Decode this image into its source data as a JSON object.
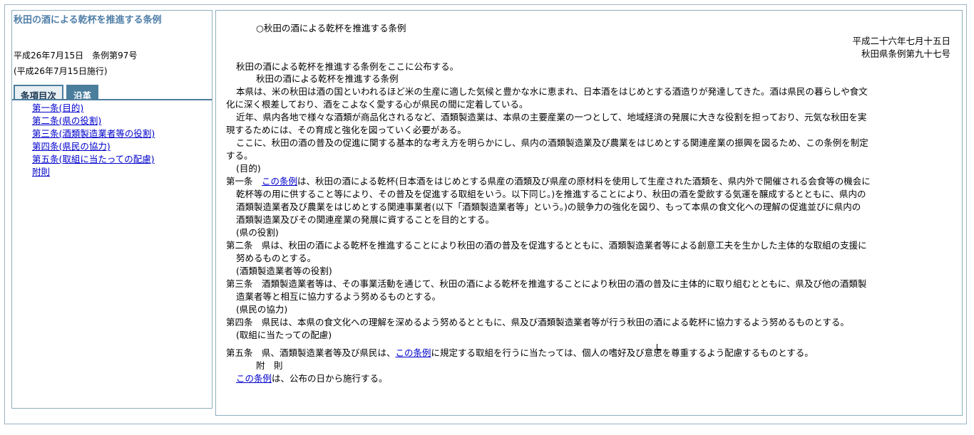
{
  "left": {
    "title": "秋田の酒による乾杯を推進する条例",
    "date_number": "平成26年7月15日　条例第97号",
    "effective": "(平成26年7月15日施行)",
    "tabs": [
      "条項目次",
      "沿革"
    ],
    "toc": [
      "第一条(目的)",
      "第二条(県の役割)",
      "第三条(酒類製造業者等の役割)",
      "第四条(県民の協力)",
      "第五条(取組に当たっての配慮)",
      "附則"
    ]
  },
  "doc": {
    "heading": "○秋田の酒による乾杯を推進する条例",
    "date": "平成二十六年七月十五日",
    "number": "秋田県条例第九十七号",
    "promulgation": "秋田の酒による乾杯を推進する条例をここに公布する。",
    "title": "秋田の酒による乾杯を推進する条例",
    "preamble": [
      "本県は、米の秋田は酒の国といわれるほど米の生産に適した気候と豊かな水に恵まれ、日本酒をはじめとする酒造りが発達してきた。酒は県民の暮らしや食文",
      "化に深く根差しており、酒をこよなく愛する心が県民の間に定着している。",
      "近年、県内各地で様々な酒類が商品化されるなど、酒類製造業は、本県の主要産業の一つとして、地域経済の発展に大きな役割を担っており、元気な秋田を実",
      "現するためには、その育成と強化を図っていく必要がある。",
      "ここに、秋田の酒の普及の促進に関する基本的な考え方を明らかにし、県内の酒類製造業及び農業をはじめとする関連産業の振興を図るため、この条例を制定",
      "する。"
    ],
    "a1_caption": "(目的)",
    "a1_label": "第一条",
    "a1_link": "この条例",
    "a1_l1": "は、秋田の酒による乾杯(日本酒をはじめとする県産の酒類及び県産の原材料を使用して生産された酒類を、県内外で開催される会食等の機会に",
    "a1_l2": "乾杯等の用に供すること等により、その普及を促進する取組をいう。以下同じ。)を推進することにより、秋田の酒を愛飲する気運を醸成するとともに、県内の",
    "a1_l3": "酒類製造業者及び農業をはじめとする関連事業者(以下「酒類製造業者等」という。)の競争力の強化を図り、もって本県の食文化への理解の促進並びに県内の",
    "a1_l4": "酒類製造業及びその関連産業の発展に資することを目的とする。",
    "a2_caption": "(県の役割)",
    "a2_l1": "第二条　県は、秋田の酒による乾杯を推進することにより秋田の酒の普及を促進するとともに、酒類製造業者等による創意工夫を生かした主体的な取組の支援に",
    "a2_l2": "努めるものとする。",
    "a3_caption": "(酒類製造業者等の役割)",
    "a3_l1": "第三条　酒類製造業者等は、その事業活動を通じて、秋田の酒による乾杯を推進することにより秋田の酒の普及に主体的に取り組むとともに、県及び他の酒類製",
    "a3_l2": "造業者等と相互に協力するよう努めるものとする。",
    "a4_caption": "(県民の協力)",
    "a4_l1": "第四条　県民は、本県の食文化への理解を深めるよう努めるとともに、県及び酒類製造業者等が行う秋田の酒による乾杯に協力するよう努めるものとする。",
    "a5_caption": "(取組に当たっての配慮)",
    "a5_pre": "第五条　県、酒類製造業者等及び県民は、",
    "a5_link": "この条例",
    "a5_post": "に規定する取組を行うに当たっては、個人の嗜好及び意思を尊重するよう配慮するものとする。",
    "supp_heading": "附　則",
    "supp_link": "この条例",
    "supp_post": "は、公布の日から施行する。"
  }
}
